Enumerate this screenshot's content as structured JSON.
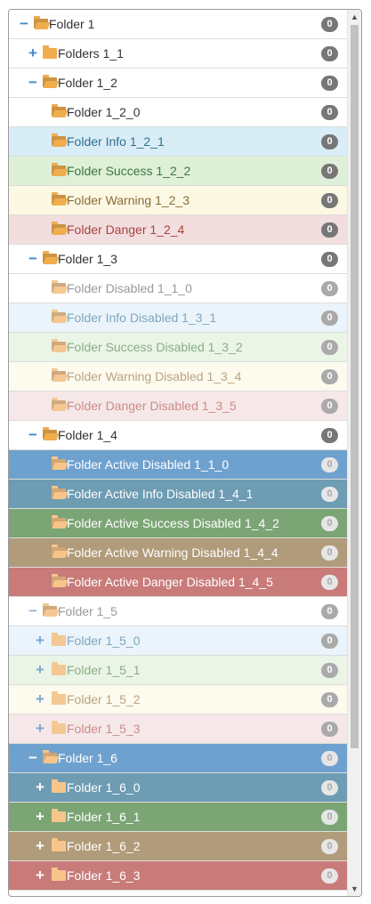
{
  "tree": {
    "items": [
      {
        "label": "Folder 1",
        "badge": "0",
        "indent": 0,
        "toggle": "−",
        "icon": "folder-open-icon",
        "style": "default"
      },
      {
        "label": "Folders 1_1",
        "badge": "0",
        "indent": 1,
        "toggle": "+",
        "icon": "folder-closed-icon",
        "style": "default"
      },
      {
        "label": "Folder 1_2",
        "badge": "0",
        "indent": 1,
        "toggle": "−",
        "icon": "folder-open-icon",
        "style": "default"
      },
      {
        "label": "Folder 1_2_0",
        "badge": "0",
        "indent": 2,
        "toggle": "",
        "icon": "folder-open-icon",
        "style": "default"
      },
      {
        "label": "Folder Info 1_2_1",
        "badge": "0",
        "indent": 2,
        "toggle": "",
        "icon": "folder-open-icon",
        "style": "info"
      },
      {
        "label": "Folder Success 1_2_2",
        "badge": "0",
        "indent": 2,
        "toggle": "",
        "icon": "folder-open-icon",
        "style": "success"
      },
      {
        "label": "Folder Warning 1_2_3",
        "badge": "0",
        "indent": 2,
        "toggle": "",
        "icon": "folder-open-icon",
        "style": "warning"
      },
      {
        "label": "Folder Danger 1_2_4",
        "badge": "0",
        "indent": 2,
        "toggle": "",
        "icon": "folder-open-icon",
        "style": "danger"
      },
      {
        "label": "Folder 1_3",
        "badge": "0",
        "indent": 1,
        "toggle": "−",
        "icon": "folder-open-icon",
        "style": "default"
      },
      {
        "label": "Folder Disabled 1_1_0",
        "badge": "0",
        "indent": 2,
        "toggle": "",
        "icon": "folder-open-icon",
        "style": "disabled"
      },
      {
        "label": "Folder Info Disabled 1_3_1",
        "badge": "0",
        "indent": 2,
        "toggle": "",
        "icon": "folder-open-icon",
        "style": "info-disabled"
      },
      {
        "label": "Folder Success Disabled 1_3_2",
        "badge": "0",
        "indent": 2,
        "toggle": "",
        "icon": "folder-open-icon",
        "style": "success-disabled"
      },
      {
        "label": "Folder Warning Disabled 1_3_4",
        "badge": "0",
        "indent": 2,
        "toggle": "",
        "icon": "folder-open-icon",
        "style": "warning-disabled"
      },
      {
        "label": "Folder Danger Disabled 1_3_5",
        "badge": "0",
        "indent": 2,
        "toggle": "",
        "icon": "folder-open-icon",
        "style": "danger-disabled"
      },
      {
        "label": "Folder 1_4",
        "badge": "0",
        "indent": 1,
        "toggle": "−",
        "icon": "folder-open-icon",
        "style": "default"
      },
      {
        "label": "Folder Active Disabled 1_1_0",
        "badge": "0",
        "indent": 2,
        "toggle": "",
        "icon": "folder-open-icon",
        "style": "active"
      },
      {
        "label": "Folder Active Info Disabled 1_4_1",
        "badge": "0",
        "indent": 2,
        "toggle": "",
        "icon": "folder-open-icon",
        "style": "active-info"
      },
      {
        "label": "Folder Active Success Disabled 1_4_2",
        "badge": "0",
        "indent": 2,
        "toggle": "",
        "icon": "folder-open-icon",
        "style": "active-success"
      },
      {
        "label": "Folder Active Warning Disabled 1_4_4",
        "badge": "0",
        "indent": 2,
        "toggle": "",
        "icon": "folder-open-icon",
        "style": "active-warning"
      },
      {
        "label": "Folder Active Danger Disabled 1_4_5",
        "badge": "0",
        "indent": 2,
        "toggle": "",
        "icon": "folder-open-icon",
        "style": "active-danger"
      },
      {
        "label": "Folder 1_5",
        "badge": "0",
        "indent": 1,
        "toggle": "−",
        "icon": "folder-open-icon",
        "style": "disabled"
      },
      {
        "label": "Folder 1_5_0",
        "badge": "0",
        "indent": 2,
        "toggle": "+",
        "icon": "folder-closed-icon",
        "style": "info-disabled"
      },
      {
        "label": "Folder 1_5_1",
        "badge": "0",
        "indent": 2,
        "toggle": "+",
        "icon": "folder-closed-icon",
        "style": "success-disabled"
      },
      {
        "label": "Folder 1_5_2",
        "badge": "0",
        "indent": 2,
        "toggle": "+",
        "icon": "folder-closed-icon",
        "style": "warning-disabled"
      },
      {
        "label": "Folder 1_5_3",
        "badge": "0",
        "indent": 2,
        "toggle": "+",
        "icon": "folder-closed-icon",
        "style": "danger-disabled"
      },
      {
        "label": "Folder 1_6",
        "badge": "0",
        "indent": 1,
        "toggle": "−",
        "icon": "folder-open-icon",
        "style": "active"
      },
      {
        "label": "Folder 1_6_0",
        "badge": "0",
        "indent": 2,
        "toggle": "+",
        "icon": "folder-closed-icon",
        "style": "active-info"
      },
      {
        "label": "Folder 1_6_1",
        "badge": "0",
        "indent": 2,
        "toggle": "+",
        "icon": "folder-closed-icon",
        "style": "active-success"
      },
      {
        "label": "Folder 1_6_2",
        "badge": "0",
        "indent": 2,
        "toggle": "+",
        "icon": "folder-closed-icon",
        "style": "active-warning"
      },
      {
        "label": "Folder 1_6_3",
        "badge": "0",
        "indent": 2,
        "toggle": "+",
        "icon": "folder-closed-icon",
        "style": "active-danger"
      }
    ]
  },
  "scrollbar": {
    "up_icon": "▲",
    "down_icon": "▼"
  },
  "colors": {
    "toggle": "#428bca",
    "folder_icon": "#f0ad4e",
    "badge": "#777777"
  }
}
